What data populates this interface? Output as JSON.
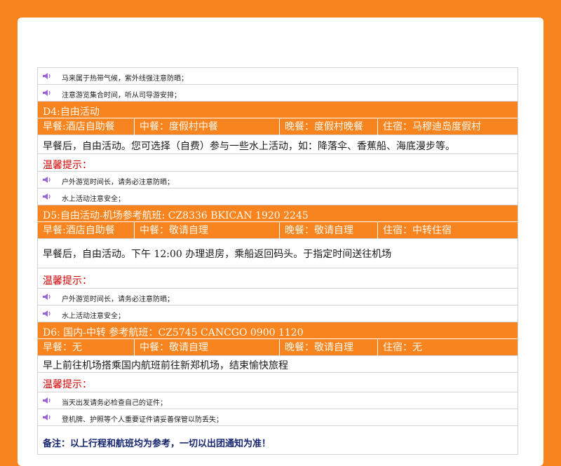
{
  "page": {
    "background_color": "#f7841f",
    "accent_color": "#f7841f",
    "warm_color": "#d40000",
    "note_color": "#14246e"
  },
  "top_tips": [
    "马来属于热带气候，紫外线强注意防晒；",
    "注意游览集合时间，听从司导游安排；"
  ],
  "days": [
    {
      "header": "D4:自由活动",
      "breakfast": "早餐:酒店自助餐",
      "lunch": "中餐：度假村中餐",
      "dinner": "晚餐：度假村晚餐",
      "lodging": "住宿：马穆迪岛度假村",
      "description": "早餐后，自由活动。您可选择（自费）参与一些水上活动，如：降落伞、香蕉船、海底漫步等。",
      "warm_label": "温馨提示：",
      "tips": [
        "户外游览时间长，请务必注意防晒；",
        "水上活动注意安全；"
      ]
    },
    {
      "header": "D5:自由活动-机场参考航班:   CZ8336     BKICAN       1920 2245",
      "breakfast": "早餐:酒店自助餐",
      "lunch": "中餐：敬请自理",
      "dinner": "晚餐：敬请自理",
      "lodging": "住宿：中转住宿",
      "description": "早餐后，自由活动。下午 12:00 办理退房，乘船返回码头。于指定时间送往机场",
      "warm_label": "温馨提示：",
      "tips": [
        "户外游览时间长，请务必注意防晒；",
        "水上活动注意安全；"
      ]
    },
    {
      "header": "D6: 国内-中转    参考航班：CZ5745    CANCGO       0900 1120",
      "breakfast": "早餐：无",
      "lunch": "中餐：敬请自理",
      "dinner": "晚餐：敬请自理",
      "lodging": "住宿：无",
      "description": "早上前往机场搭乘国内航班前往新郑机场，结束愉快旅程",
      "warm_label": "温馨提示：",
      "tips": [
        "当天出发请务必检查自己的证件；",
        "登机牌、护照等个人重要证件请妥善保管以防丢失；"
      ]
    }
  ],
  "footer_note": "备注：以上行程和航班均为参考，一切以出团通知为准！",
  "icons": {
    "tip_icon": "speaker-icon"
  }
}
